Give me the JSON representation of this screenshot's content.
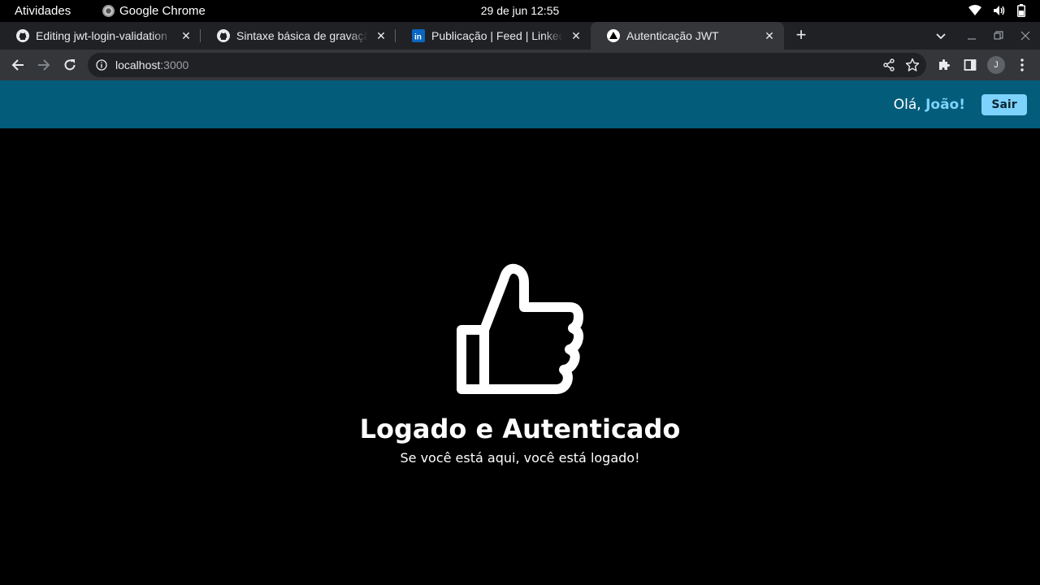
{
  "os": {
    "activities": "Atividades",
    "app_name": "Google Chrome",
    "clock": "29 de jun  12:55",
    "tray_icons": [
      "wifi-icon",
      "volume-icon",
      "battery-icon"
    ]
  },
  "browser": {
    "tabs": [
      {
        "title": "Editing jwt-login-validation",
        "favicon": "github-icon"
      },
      {
        "title": "Sintaxe básica de gravação",
        "favicon": "github-icon"
      },
      {
        "title": "Publicação | Feed | LinkedIn",
        "favicon": "linkedin-icon"
      },
      {
        "title": "Autenticação JWT",
        "favicon": "app-icon",
        "active": true
      }
    ],
    "url_host": "localhost",
    "url_port": ":3000",
    "profile_initial": "J"
  },
  "page": {
    "greeting_prefix": "Olá, ",
    "user_name": "João!",
    "logout_label": "Sair",
    "hero_icon": "thumbs-up-icon",
    "title": "Logado e Autenticado",
    "subtitle": "Se você está aqui, você está logado!"
  },
  "colors": {
    "navbar": "#025c7a",
    "accent": "#7dd3fc",
    "background": "#000000"
  }
}
